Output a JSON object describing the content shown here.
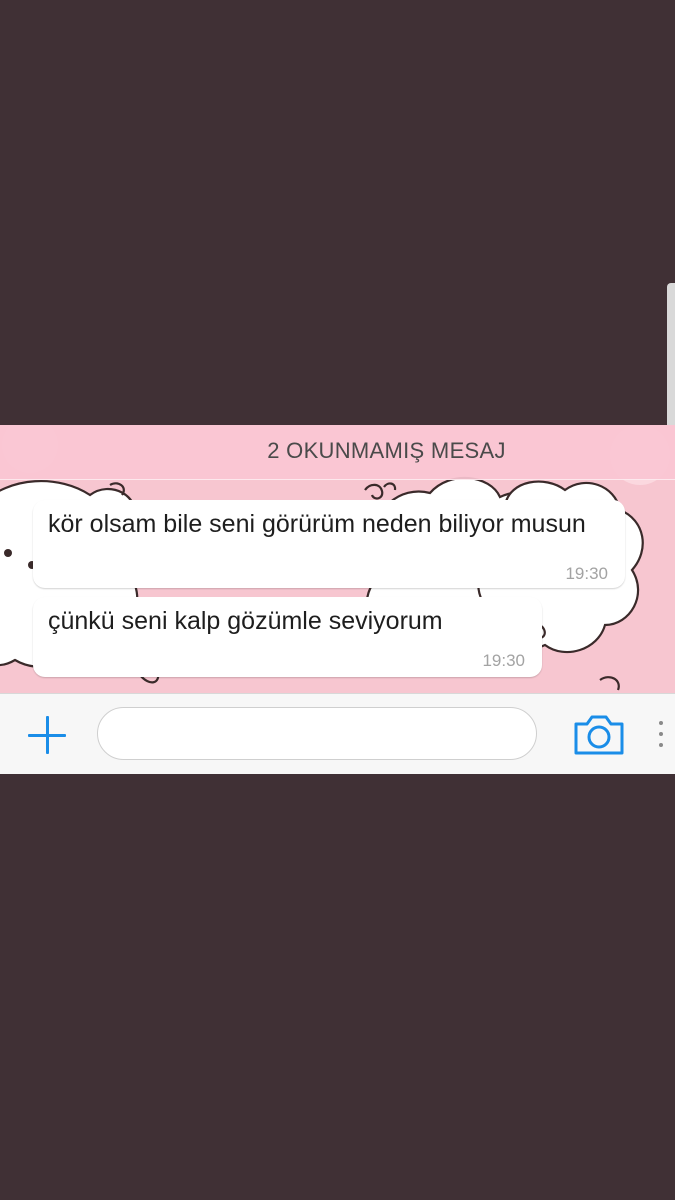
{
  "banner": {
    "unread_text": "2 OKUNMAMIŞ MESAJ"
  },
  "messages": [
    {
      "text": "kör olsam bile seni görürüm neden biliyor musun",
      "time": "19:30"
    },
    {
      "text": "çünkü seni kalp gözümle seviyorum",
      "time": "19:30"
    }
  ],
  "composer": {
    "plus_icon": "plus-icon",
    "camera_icon": "camera-icon",
    "more_icon": "more-vertical-icon",
    "input_value": "",
    "input_placeholder": ""
  },
  "colors": {
    "page_background": "#403035",
    "chat_wallpaper": "#f7c6d0",
    "accent": "#1a8de8",
    "bubble": "#ffffff"
  }
}
